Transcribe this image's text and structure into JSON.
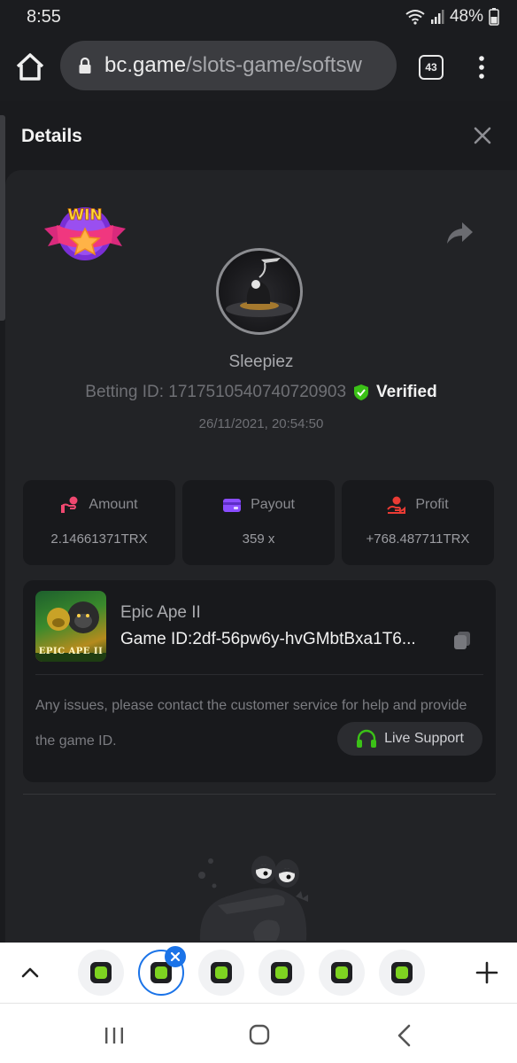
{
  "status_bar": {
    "time": "8:55",
    "battery": "48%"
  },
  "browser": {
    "url_domain": "bc.game",
    "url_path": "/slots-game/softsw",
    "tab_count": "43"
  },
  "panel": {
    "title": "Details"
  },
  "bet": {
    "username": "Sleepiez",
    "betting_id_label": "Betting ID: 1717510540740720903",
    "verified_label": "Verified",
    "timestamp": "26/11/2021, 20:54:50",
    "win_badge_text": "WIN"
  },
  "stats": [
    {
      "label": "Amount",
      "value": "2.14661371TRX",
      "icon": "amount-icon"
    },
    {
      "label": "Payout",
      "value": "359 x",
      "icon": "wallet-icon"
    },
    {
      "label": "Profit",
      "value": "+768.487711TRX",
      "icon": "profit-icon"
    }
  ],
  "game": {
    "name": "Epic Ape II",
    "id_label": "Game ID:",
    "id_value": "2df-56pw6y-hvGMbtBxa1T6...",
    "thumbnail_text": "EPIC APE II",
    "issues_text": "Any issues, please contact the customer service for help and provide the game ID.",
    "live_support_label": "Live Support"
  },
  "colors": {
    "accent_green": "#7ed321",
    "verified_green": "#3bc117",
    "tab_active_blue": "#1a73e8"
  }
}
